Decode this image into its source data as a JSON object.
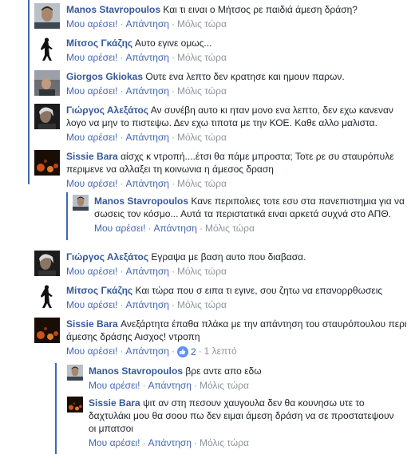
{
  "actions": {
    "like": "Μου αρέσει!",
    "reply": "Απάντηση",
    "time_now": "Μόλις τώρα",
    "time_1min": "1 λεπτό"
  },
  "comments": [
    {
      "author": "Manos Stavropoulos",
      "text": "Και τι ειναι ο Μήτσος ρε παιδιά άμεση δράση?"
    },
    {
      "author": "Μίτσος Γκάζης",
      "text": "Αυτο εγινε ομως..."
    },
    {
      "author": "Giorgos Gkiokas",
      "text": "Ουτε ενα λεπτο δεν κρατησε και ημουν παρων."
    },
    {
      "author": "Γιώργος Αλεξάτος",
      "text": "Αν συνέβη αυτο κι ηταν μονο ενα λεπτο, δεν εχω κανεναν λογο να μην το πιστεψω. Δεν εχω τιποτα με την ΚΟΕ. Καθε αλλο μαλιστα."
    },
    {
      "author": "Sissie Bara",
      "text": "αίσχς κ ντροπή....έτσι θα πάμε μπροστα; Τοτε ρε συ σταυρόπυλε περιμενε να αλλαξει τη κοινωνια η άμεσος δραση"
    },
    {
      "author": "Manos Stavropoulos",
      "text": "Κανε περιπολιες τοτε εσυ στα πανεπιστημια για να σωσεις τον κόσμο... Αυτά τα περιστατικά ειναι αρκετά συχνά στο ΑΠΘ."
    },
    {
      "author": "Γιώργος Αλεξάτος",
      "text": "Εγραψα με βαση αυτο που διαβασα."
    },
    {
      "author": "Μίτσος Γκάζης",
      "text": "Και τώρα που σ ειπα τι εγινε, σου ζητω να επανορρθωσεις"
    },
    {
      "author": "Sissie Bara",
      "text": "Ανεξάρτητα έπαθα πλάκα με την απάντηση του σταυρόπουλου περι άμεσης δράσης Αισχος! ντροπη",
      "likes": "2"
    },
    {
      "author": "Manos Stavropoulos",
      "text": "βρε αντε απο εδω"
    },
    {
      "author": "Sissie Bara",
      "text": "ψιτ αν στη πεσουν χαυγουλα δεν θα κουνησω υτε το δαχτυλάκι μου θα σοου πω δεν ειμαι άμεση δράση να σε προστατεψουν οι μπατσοι"
    }
  ]
}
